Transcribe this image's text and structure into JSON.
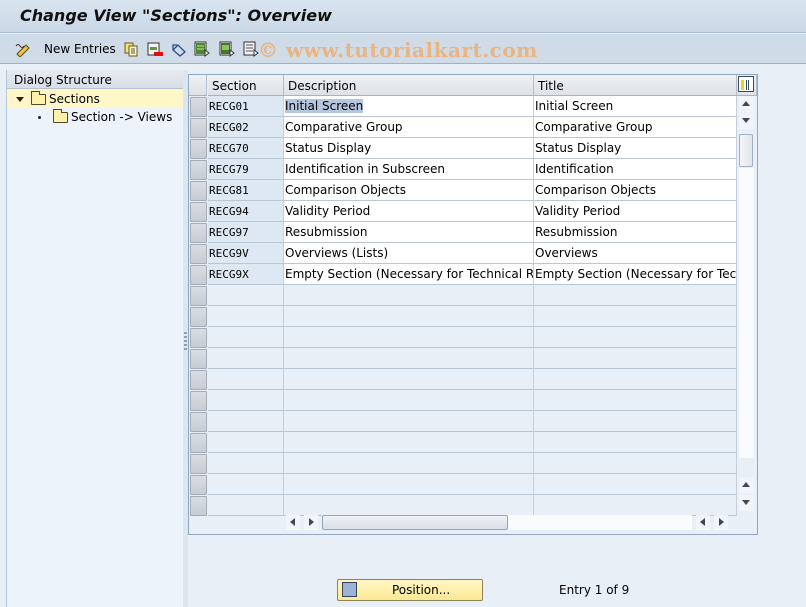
{
  "window": {
    "title": "Change View \"Sections\": Overview"
  },
  "toolbar": {
    "items": [
      {
        "icon": "edit-pencil-icon"
      },
      {
        "label": "New Entries"
      },
      {
        "icon": "copy-icon"
      },
      {
        "icon": "delete-icon"
      },
      {
        "icon": "undo-change-icon"
      },
      {
        "icon": "select-all-icon"
      },
      {
        "icon": "select-block-icon"
      },
      {
        "icon": "deselect-all-icon"
      }
    ],
    "watermark": "© www.tutorialkart.com"
  },
  "dialog_structure": {
    "header": "Dialog Structure",
    "items": [
      {
        "label": "Sections",
        "expanded": true,
        "selected": true
      },
      {
        "label": "Section -> Views",
        "expanded": false,
        "selected": false
      }
    ]
  },
  "table": {
    "columns": [
      "Section",
      "Description",
      "Title"
    ],
    "rows": [
      {
        "section": "RECG01",
        "description": "Initial Screen",
        "title": "Initial Screen"
      },
      {
        "section": "RECG02",
        "description": "Comparative Group",
        "title": "Comparative Group"
      },
      {
        "section": "RECG70",
        "description": "Status Display",
        "title": "Status Display"
      },
      {
        "section": "RECG79",
        "description": "Identification in Subscreen",
        "title": "Identification"
      },
      {
        "section": "RECG81",
        "description": "Comparison Objects",
        "title": "Comparison Objects"
      },
      {
        "section": "RECG94",
        "description": "Validity Period",
        "title": "Validity Period"
      },
      {
        "section": "RECG97",
        "description": "Resubmission",
        "title": "Resubmission"
      },
      {
        "section": "RECG9V",
        "description": "Overviews (Lists)",
        "title": "Overviews"
      },
      {
        "section": "RECG9X",
        "description": "Empty Section (Necessary for Technical Rea…",
        "title": "Empty Section (Necessary for Techn"
      }
    ],
    "empty_rows": 11
  },
  "footer": {
    "position_button": "Position...",
    "entry_info": "Entry 1 of 9"
  }
}
